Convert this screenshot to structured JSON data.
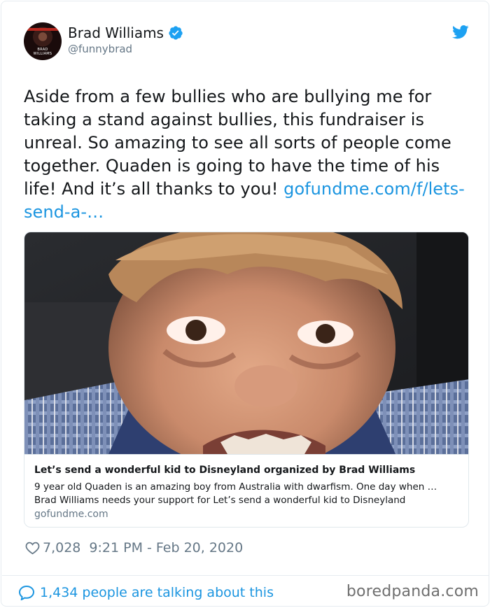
{
  "author": {
    "name": "Brad Williams",
    "handle": "@funnybrad",
    "avatar_caption": "BRAD WILLIAMS",
    "verified_icon": "verified-badge-icon"
  },
  "tweet": {
    "text": "Aside from a few bullies who are bullying me for taking a stand against bullies, this fundraiser is unreal. So amazing to see all sorts of people come together. Quaden is going to have the time of his life! And it’s all thanks to you! ",
    "link": "gofundme.com/f/lets-send-a-…"
  },
  "card": {
    "title": "Let’s send a wonderful kid to Disneyland organized by Brad Williams",
    "description_line1": "9 year old Quaden is an amazing boy from Australia with dwarfism. One day when …",
    "description_line2": "Brad Williams needs your support for Let’s send a wonderful kid to Disneyland",
    "domain": "gofundme.com"
  },
  "meta": {
    "likes": "7,028",
    "timestamp": "9:21 PM - Feb 20, 2020"
  },
  "footer": {
    "talking": "1,434 people are talking about this",
    "watermark": "boredpanda.com"
  },
  "colors": {
    "link": "#1b95e0",
    "secondary_text": "#657786",
    "border": "#e1e8ed"
  },
  "icons": [
    "verified-badge-icon",
    "twitter-bird-icon",
    "heart-icon",
    "speech-bubble-icon"
  ]
}
